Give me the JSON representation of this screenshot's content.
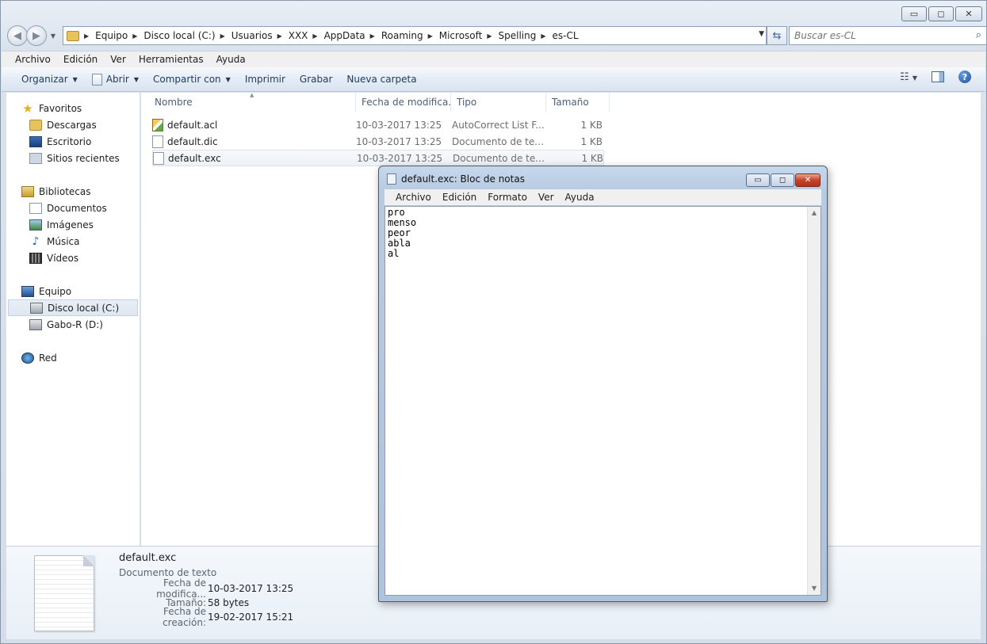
{
  "explorer": {
    "window_buttons": {
      "minimize": "▭",
      "maximize": "◻",
      "close": "✕"
    },
    "address": {
      "crumbs": [
        "Equipo",
        "Disco local (C:)",
        "Usuarios",
        "XXX",
        "AppData",
        "Roaming",
        "Microsoft",
        "Spelling",
        "es-CL"
      ]
    },
    "search": {
      "placeholder": "Buscar es-CL"
    },
    "menubar": [
      "Archivo",
      "Edición",
      "Ver",
      "Herramientas",
      "Ayuda"
    ],
    "toolbar": {
      "organize": "Organizar",
      "open": "Abrir",
      "share": "Compartir con",
      "print": "Imprimir",
      "burn": "Grabar",
      "new_folder": "Nueva carpeta"
    },
    "sidebar": {
      "favorites": "Favoritos",
      "downloads": "Descargas",
      "desktop": "Escritorio",
      "recent": "Sitios recientes",
      "libraries": "Bibliotecas",
      "documents": "Documentos",
      "images": "Imágenes",
      "music": "Música",
      "videos": "Vídeos",
      "computer": "Equipo",
      "drive_c": "Disco local (C:)",
      "drive_d": "Gabo-R (D:)",
      "network": "Red"
    },
    "columns": {
      "name": "Nombre",
      "date": "Fecha de modifica...",
      "type": "Tipo",
      "size": "Tamaño"
    },
    "files": [
      {
        "name": "default.acl",
        "date": "10-03-2017 13:25",
        "type": "AutoCorrect List F...",
        "size": "1 KB"
      },
      {
        "name": "default.dic",
        "date": "10-03-2017 13:25",
        "type": "Documento de tex...",
        "size": "1 KB"
      },
      {
        "name": "default.exc",
        "date": "10-03-2017 13:25",
        "type": "Documento de tex...",
        "size": "1 KB"
      }
    ],
    "details": {
      "name": "default.exc",
      "kind": "Documento de texto",
      "modified_label": "Fecha de modifica...",
      "modified_value": "10-03-2017 13:25",
      "size_label": "Tamaño:",
      "size_value": "58 bytes",
      "created_label": "Fecha de creación:",
      "created_value": "19-02-2017 15:21"
    }
  },
  "notepad": {
    "title": "default.exc: Bloc de notas",
    "menu": [
      "Archivo",
      "Edición",
      "Formato",
      "Ver",
      "Ayuda"
    ],
    "content": "pro\nmenso\npeor\nabla\nal"
  }
}
